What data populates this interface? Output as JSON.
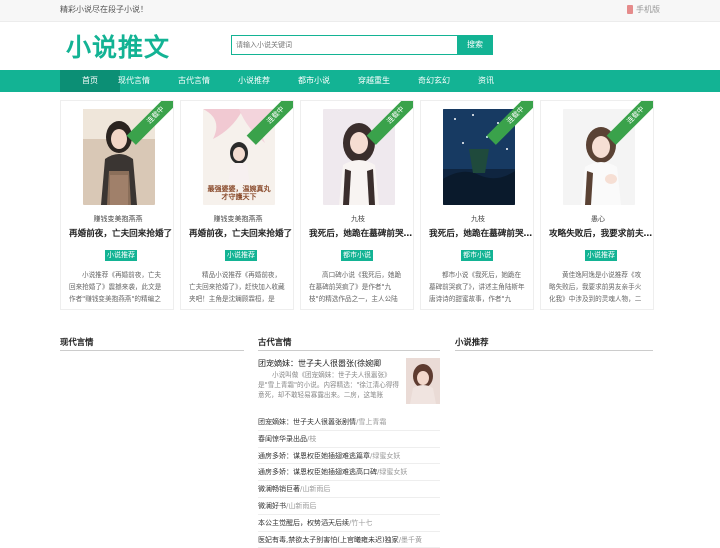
{
  "topbar": {
    "notice": "精彩小说尽在段子小说！",
    "mobile_label": "手机版"
  },
  "header": {
    "logo": "小说推文",
    "search_placeholder": "请输入小说关键词",
    "search_button": "搜索"
  },
  "nav": [
    "首页",
    "现代言情",
    "古代言情",
    "小说推荐",
    "都市小说",
    "穿越重生",
    "奇幻玄幻",
    "资讯"
  ],
  "nav_active": "首页",
  "ribbon_label": "连载中",
  "cards": [
    {
      "author": "赚钱变美抱燕燕",
      "title": "再婚前夜，亡夫回来抢婚了",
      "tag": "小说推荐",
      "summary": "小说推荐《再婚前夜，亡夫回来抢婚了》震撼来袭，此文是作者\"赚钱变美抱燕燕\"的精编之"
    },
    {
      "author": "赚钱变美抱燕燕",
      "title": "再婚前夜，亡夫回来抢婚了",
      "tag": "小说推荐",
      "summary": "精品小说推荐《再婚前夜，亡夫回来抢婚了》，赶快加入收藏夹吧！主角是沈斓顾霖桓，是",
      "cover_text": "最强婆婆，温婉真丸才守護天下"
    },
    {
      "author": "九枝",
      "title": "我死后，她跪在墓碑前哭疯了",
      "tag": "都市小说",
      "summary": "高口碑小说《我死后，她跪在墓碑前哭疯了》是作者\"九枝\"的精选作品之一，主人公陆"
    },
    {
      "author": "九枝",
      "title": "我死后，她跪在墓碑前哭疯了",
      "tag": "都市小说",
      "summary": "都市小说《我死后，她跪在墓碑前哭疯了》，讲述主角陆斯年唐诗诗的甜蜜故事，作者\"九"
    },
    {
      "author": "愚心",
      "title": "攻略失败后，我要求前夫还债",
      "tag": "小说推荐",
      "summary": "黄佳逸阿逸是小说推荐《攻略失败后，我要求前男友亲手火化我》中涉及到的灵魂人物，二"
    }
  ],
  "sections": {
    "modern": "现代言情",
    "ancient": "古代言情",
    "recommend": "小说推荐"
  },
  "feature": {
    "title": "团宠嫡妹：世子夫人很嚣张(徐婉卿",
    "summary": "小说叫做《团宠嫡妹：世子夫人很嚣张》是\"雪上青霜\"的小说。内容精选：\"徐江清心得得意死，却不敢轻易寡露出来。二房，这笔账"
  },
  "list": [
    {
      "title": "团宠嫡妹：世子夫人很嚣张剧情",
      "author": "雪上青霜"
    },
    {
      "title": "春闺惊华录出品",
      "author": "枝"
    },
    {
      "title": "通房多娇：谋恩权臣她插翅难逃篇章",
      "author": "绿蜜女妖"
    },
    {
      "title": "通房多娇：谋恩权臣她插翅难逃高口碑",
      "author": "绿蜜女妖"
    },
    {
      "title": "微澜畅销巨著",
      "author": "山新雨后"
    },
    {
      "title": "微澜好书",
      "author": "山新雨后"
    },
    {
      "title": "本公主觉醒后，权势滔天后续",
      "author": "竹十七"
    },
    {
      "title": "医妃有毒,禁欲太子别害怕(上官曦雍未迟)独家",
      "author": "墨千黄"
    }
  ]
}
